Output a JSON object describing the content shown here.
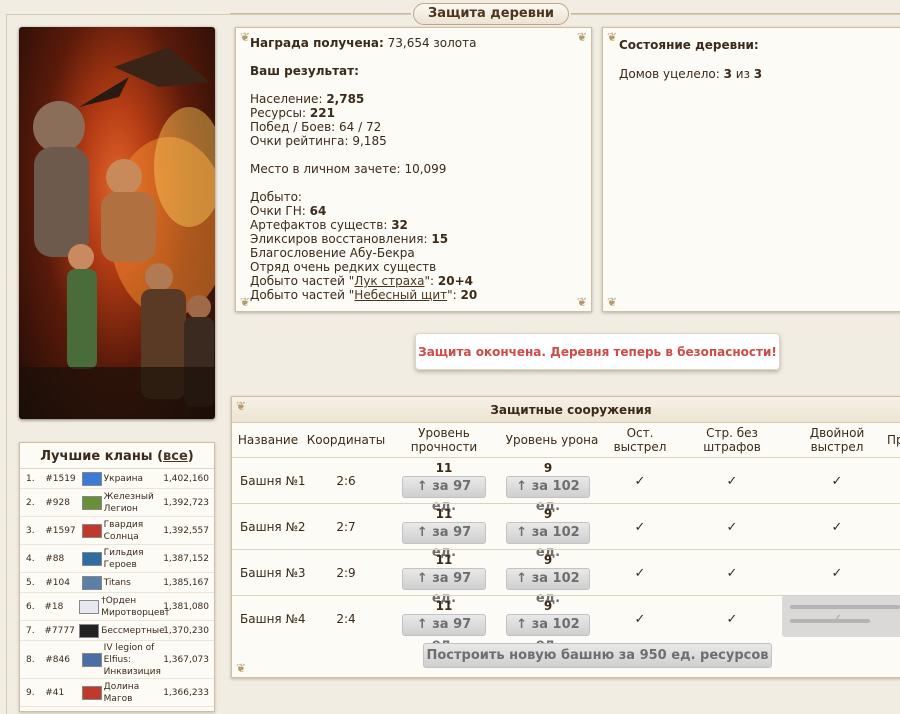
{
  "page_title": "Защита деревни",
  "results": {
    "reward_label": "Награда получена:",
    "reward_value": "73,654 золота",
    "your_result": "Ваш результат:",
    "population_label": "Население:",
    "population_value": "2,785",
    "resources_label": "Ресурсы:",
    "resources_value": "221",
    "wins_label": "Побед / Боев:",
    "wins_value": "64 / 72",
    "rating_label": "Очки рейтинга:",
    "rating_value": "9,185",
    "place_label": "Место в личном зачете:",
    "place_value": "10,099",
    "obtained_label": "Добыто:",
    "gn_label": "Очки ГН:",
    "gn_value": "64",
    "artifacts_label": "Артефактов существ:",
    "artifacts_value": "32",
    "elixirs_label": "Эликсиров восстановления:",
    "elixirs_value": "15",
    "blessing": "Благословение Абу-Бекра",
    "rare_squad": "Отряд очень редких существ",
    "parts1_prefix": "Добыто частей \"",
    "parts1_link": "Лук страха",
    "parts1_suffix": "\":",
    "parts1_value": "20+4",
    "parts2_prefix": "Добыто частей \"",
    "parts2_link": "Небесный щит",
    "parts2_suffix": "\":",
    "parts2_value": "20"
  },
  "village": {
    "title": "Состояние деревни:",
    "houses_label": "Домов уцелело:",
    "houses_value": "3",
    "houses_of": "из",
    "houses_total": "3"
  },
  "message": "Защита окончена. Деревня теперь в безопасности!",
  "clans": {
    "title": "Лучшие кланы",
    "all_link": "все",
    "rows": [
      {
        "n": "1.",
        "id": "#1519",
        "name": "Украина",
        "score": "1,402,160",
        "flag": "#3a7bd5"
      },
      {
        "n": "2.",
        "id": "#928",
        "name": "Железный Легион",
        "score": "1,392,723",
        "flag": "#6a8f3a"
      },
      {
        "n": "3.",
        "id": "#1597",
        "name": "Гвардия Солнца",
        "score": "1,392,557",
        "flag": "#c0392b"
      },
      {
        "n": "4.",
        "id": "#88",
        "name": "Гильдия Героев",
        "score": "1,387,152",
        "flag": "#2e6da4"
      },
      {
        "n": "5.",
        "id": "#104",
        "name": "Titans",
        "score": "1,385,167",
        "flag": "#5b7fa6"
      },
      {
        "n": "6.",
        "id": "#18",
        "name": "†Орден Миротворцев†",
        "score": "1,381,080",
        "flag": "#e8e8f0"
      },
      {
        "n": "7.",
        "id": "#7777",
        "name": "Бессмертные",
        "score": "1,370,230",
        "flag": "#222222"
      },
      {
        "n": "8.",
        "id": "#846",
        "name": "IV legion of Elfius: Инквизиция",
        "score": "1,367,073",
        "flag": "#4a6fa5"
      },
      {
        "n": "9.",
        "id": "#41",
        "name": "Долина Магов",
        "score": "1,366,233",
        "flag": "#c0392b"
      }
    ]
  },
  "defense": {
    "title": "Защитные сооружения",
    "headers": {
      "name": "Название",
      "coords": "Координаты",
      "strength": "Уровень прочности",
      "damage": "Уровень урона",
      "stop_shot": "Ост. выстрел",
      "no_penalty": "Стр. без штрафов",
      "double_shot": "Двойной выстрел",
      "extra": "Пр"
    },
    "check": "✓",
    "towers": [
      {
        "name": "Башня №1",
        "coords": "2:6",
        "strength": "11",
        "strength_btn": "↑ за 97 ед.",
        "damage": "9",
        "damage_btn": "↑ за 102 ед."
      },
      {
        "name": "Башня №2",
        "coords": "2:7",
        "strength": "11",
        "strength_btn": "↑ за 97 ед.",
        "damage": "9",
        "damage_btn": "↑ за 102 ед."
      },
      {
        "name": "Башня №3",
        "coords": "2:9",
        "strength": "11",
        "strength_btn": "↑ за 97 ед.",
        "damage": "9",
        "damage_btn": "↑ за 102 ед."
      },
      {
        "name": "Башня №4",
        "coords": "2:4",
        "strength": "11",
        "strength_btn": "↑ за 97 ед.",
        "damage": "9",
        "damage_btn": "↑ за 102 ед."
      }
    ],
    "build_button": "Построить новую башню за 950 ед. ресурсов"
  }
}
